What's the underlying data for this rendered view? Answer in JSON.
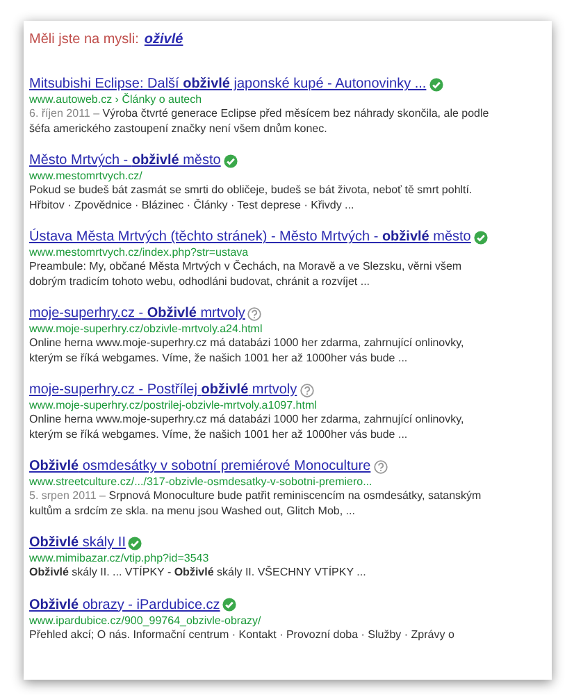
{
  "suggestion": {
    "label": "Měli jste na mysli:",
    "query": "oživlé"
  },
  "results": [
    {
      "title": "Mitsubishi Eclipse: Další **obživlé** japonské kupé - Autonovinky ...",
      "verified": true,
      "url": "www.autoweb.cz › Články o autech",
      "date": "6. říjen 2011 –",
      "snippet": "Výroba čtvrté generace Eclipse před měsícem bez náhrady skončila, ale podle šéfa amerického zastoupení značky není všem dnům konec."
    },
    {
      "title": "Město Mrtvých - **obživlé** město",
      "verified": true,
      "url": "www.mestomrtvych.cz/",
      "snippet": "Pokud se budeš bát zasmát se smrti do obličeje, budeš se bát života, neboť tě smrt pohltí. Hřbitov · Zpovědnice · Blázinec · Články · Test deprese · Křivdy ..."
    },
    {
      "title": "Ústava Města Mrtvých (těchto stránek) - Město Mrtvých - **obživlé** město",
      "verified": true,
      "url": "www.mestomrtvych.cz/index.php?str=ustava",
      "snippet": "Preambule: My, občané Města Mrtvých v Čechách, na Moravě a ve Slezsku, věrni všem dobrým tradicím tohoto webu, odhodláni budovat, chránit a rozvíjet ..."
    },
    {
      "title": "moje-superhry.cz - **Obživlé** mrtvoly",
      "verified": false,
      "url": "www.moje-superhry.cz/obzivle-mrtvoly.a24.html",
      "snippet": "Online herna www.moje-superhry.cz má databázi 1000 her zdarma, zahrnující onlinovky, kterým se říká webgames. Víme, že našich 1001 her až 1000her vás bude ..."
    },
    {
      "title": "moje-superhry.cz - Postřílej **obživlé** mrtvoly",
      "verified": false,
      "url": "www.moje-superhry.cz/postrilej-obzivle-mrtvoly.a1097.html",
      "snippet": "Online herna www.moje-superhry.cz má databázi 1000 her zdarma, zahrnující onlinovky, kterým se říká webgames. Víme, že našich 1001 her až 1000her vás bude ..."
    },
    {
      "title": "**Obživlé** osmdesátky v sobotní premiérové Monoculture",
      "verified": false,
      "url": "www.streetculture.cz/.../317-obzivle-osmdesatky-v-sobotni-premiero...",
      "date": "5. srpen 2011 –",
      "snippet": "Srpnová Monoculture bude patřit reminiscencím na osmdesátky, satanským kultům a srdcím ze skla. na menu jsou Washed out, Glitch Mob, ..."
    },
    {
      "title": "**Obživlé** skály II",
      "verified": true,
      "url": "www.mimibazar.cz/vtip.php?id=3543",
      "snippet": "**Obživlé** skály II. ... VTÍPKY - **Obživlé** skály II. VŠECHNY VTÍPKY ..."
    },
    {
      "title": "**Obživlé** obrazy - iPardubice.cz",
      "verified": true,
      "url": "www.ipardubice.cz/900_99764_obzivle-obrazy/",
      "snippet": "Přehled akcí; O nás. Informační centrum · Kontakt · Provozní doba · Služby · Zprávy o"
    }
  ]
}
